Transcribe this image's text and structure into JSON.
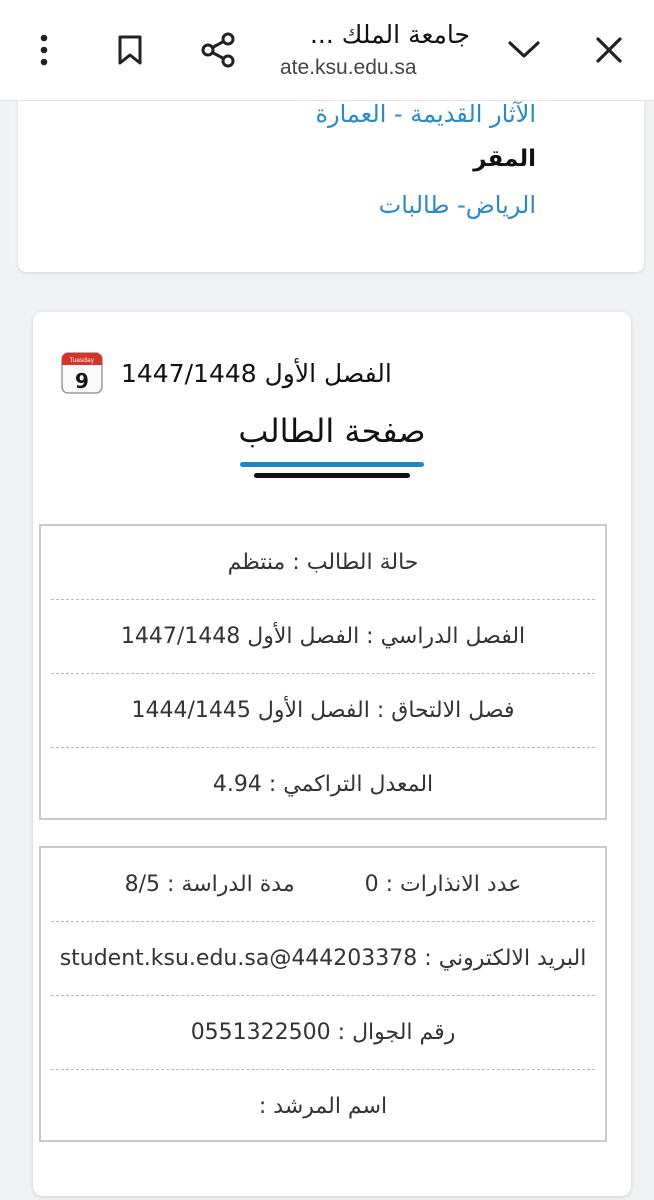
{
  "browser": {
    "page_title": "جامعة الملك ...",
    "url_host": "ate.ksu.edu.sa",
    "icons": [
      "close-icon",
      "chevron-down-icon",
      "share-icon",
      "bookmark-icon",
      "more-vert-icon"
    ]
  },
  "top_card": {
    "major_link": "الآثار القديمة - العمارة",
    "campus_label": "المقر",
    "campus_value": "الرياض- طالبات"
  },
  "student_card": {
    "semester": "الفصل الأول 1447/1448",
    "calendar_icon_day": "9",
    "calendar_icon_weekday": "Tuesday",
    "title": "صفحة الطالب",
    "summary_rows": [
      "حالة الطالب : منتظم",
      "الفصل الدراسي : الفصل الأول 1447/1448",
      "فصل الالتحاق : الفصل الأول 1444/1445",
      "المعدل التراكمي : 4.94"
    ],
    "warnings": "عدد الانذارات : 0",
    "study_duration": "مدة الدراسة : 8/5",
    "email": "البريد الالكتروني : 444203378@student.ksu.edu.sa",
    "mobile": "رقم الجوال : 0551322500",
    "advisor": "اسم المرشد :"
  },
  "colors": {
    "link": "#2a8ac6",
    "accent_blue": "#1f87c2",
    "page_bg": "#f1f2f4"
  }
}
